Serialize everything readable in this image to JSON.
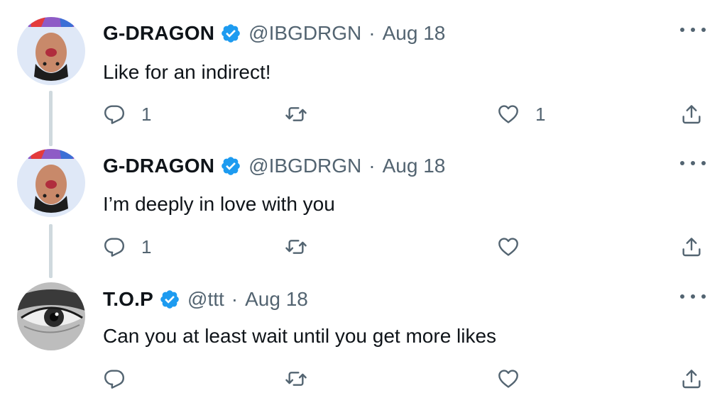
{
  "tweets": [
    {
      "name": "G-DRAGON",
      "handle": "@IBGDRGN",
      "separator": "·",
      "date": "Aug 18",
      "text": "Like for an indirect!",
      "replies": "1",
      "likes": "1",
      "avatar": "gd-avatar",
      "verified": true
    },
    {
      "name": "G-DRAGON",
      "handle": "@IBGDRGN",
      "separator": "·",
      "date": "Aug 18",
      "text": "I’m deeply in love with you",
      "replies": "1",
      "likes": "",
      "avatar": "gd-avatar",
      "verified": true
    },
    {
      "name": "T.O.P",
      "handle": "@ttt",
      "separator": "·",
      "date": "Aug 18",
      "text": "Can you at least wait until you get more likes",
      "replies": "",
      "likes": "",
      "avatar": "top-avatar",
      "verified": true
    }
  ],
  "colors": {
    "text": "#0f1419",
    "secondary": "#536471",
    "verified": "#1d9bf0",
    "thread_line": "#cfd9de"
  },
  "icons": {
    "reply": "reply-icon",
    "retweet": "retweet-icon",
    "like": "heart-icon",
    "share": "share-icon",
    "more": "more-icon",
    "verified": "verified-badge-icon"
  }
}
